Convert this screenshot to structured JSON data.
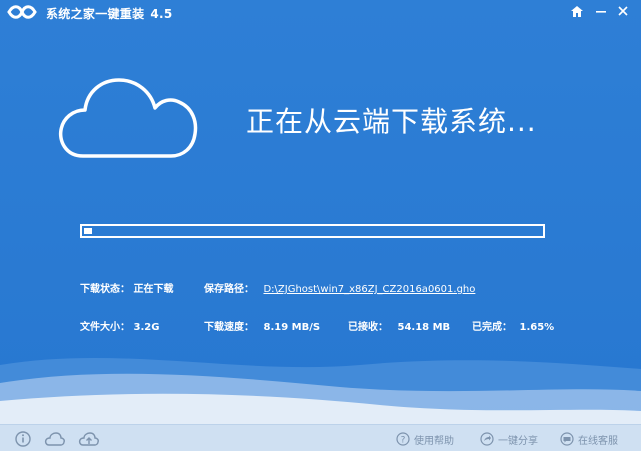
{
  "app": {
    "name": "系统之家一键重装",
    "version": "4.5"
  },
  "status": {
    "heading": "正在从云端下载系统..."
  },
  "progress": {
    "fraction": 0.0165
  },
  "info": {
    "download_status_label": "下载状态：",
    "download_status_value": "正在下载",
    "save_path_label": "保存路径：",
    "save_path_value": "D:\\ZJGhost\\win7_x86ZJ_CZ2016a0601.gho",
    "file_size_label": "文件大小：",
    "file_size_value": "3.2G",
    "speed_label": "下载速度：",
    "speed_value": "8.19 MB/S",
    "received_label": "已接收：",
    "received_value": "54.18 MB",
    "completed_label": "已完成：",
    "completed_value": "1.65%"
  },
  "footer": {
    "help_label": "使用帮助",
    "share_label": "一键分享",
    "support_label": "在线客服"
  },
  "colors": {
    "background": "#2e7fd6",
    "footer_bg": "#cfe0f2",
    "footer_text": "#7d93ad",
    "wave_light": "#e3edf8"
  },
  "icons": [
    "app-logo-icon",
    "home-icon",
    "minimize-icon",
    "close-icon",
    "cloud-icon",
    "info-icon",
    "cloud-outline-icon",
    "cloud-upload-icon",
    "help-icon",
    "share-icon",
    "chat-icon"
  ]
}
